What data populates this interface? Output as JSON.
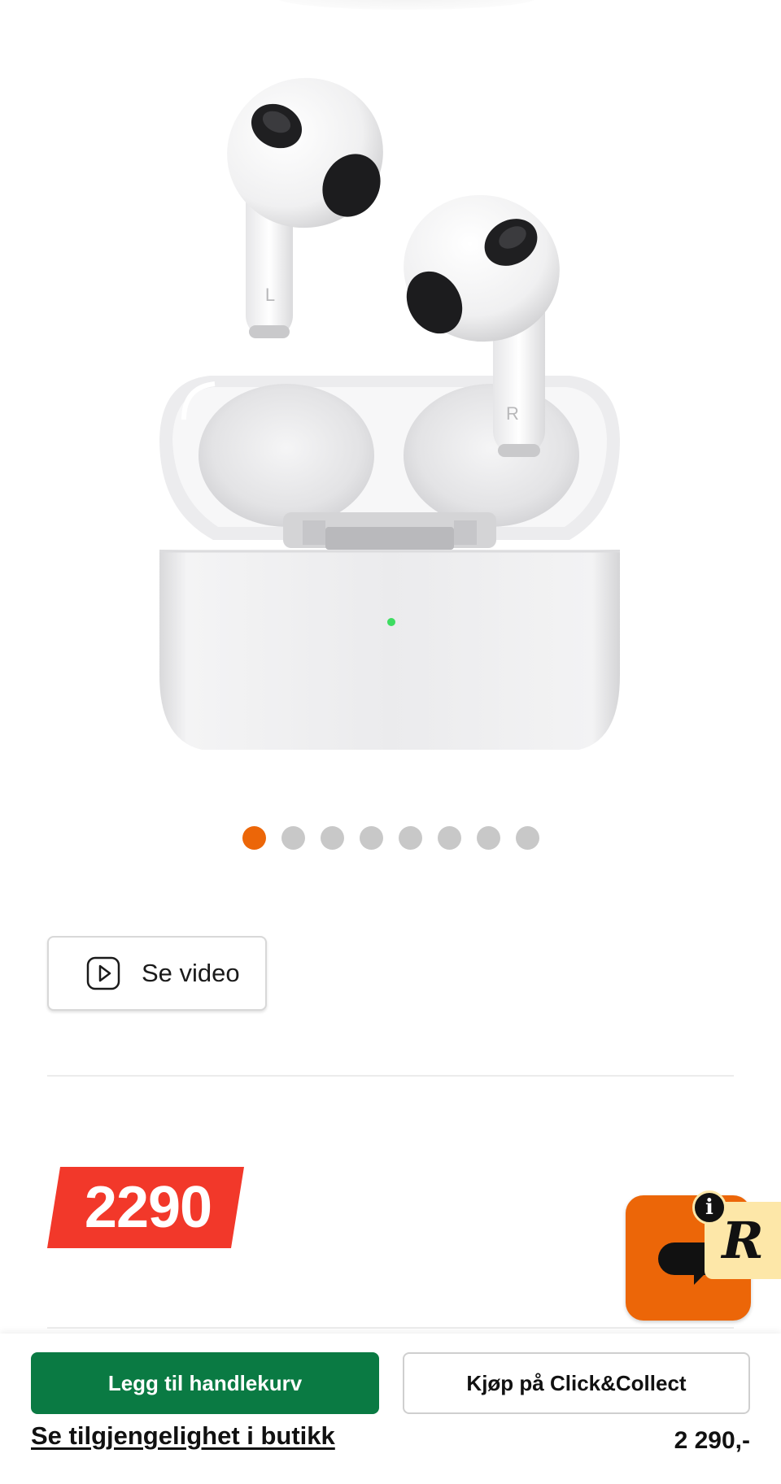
{
  "product": {
    "image_alt": "AirPods",
    "earbud_left_mark": "L",
    "earbud_right_mark": "R"
  },
  "carousel": {
    "dot_count": 8,
    "active_index": 0
  },
  "video_button": {
    "label": "Se video",
    "icon": "play-icon"
  },
  "price_badge": {
    "value": "2290",
    "color": "#f2382a"
  },
  "widget": {
    "review_letter": "R",
    "info_label": "i",
    "chat_color": "#ec6608",
    "review_color": "#fde7a8"
  },
  "actions": {
    "add_to_cart_label": "Legg til handlekurv",
    "click_collect_label": "Kjøp på Click&Collect",
    "availability_link": "Se tilgjengelighet i butikk",
    "price": "2 290,-",
    "primary_color": "#0a7a43"
  }
}
